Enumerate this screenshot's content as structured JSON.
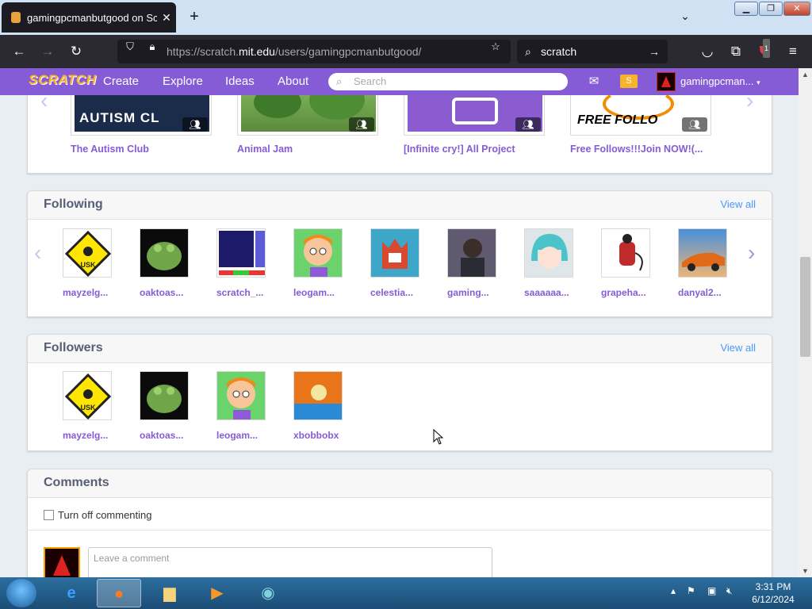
{
  "browser": {
    "tab_title": "gamingpcmanbutgood on Scratch",
    "url_prefix": "https://scratch.",
    "url_domain": "mit.edu",
    "url_path": "/users/gamingpcmanbutgood/",
    "search_value": "scratch",
    "extension_badge": "1"
  },
  "header": {
    "logo": "SCRATCH",
    "nav": [
      "Create",
      "Explore",
      "Ideas",
      "About"
    ],
    "search_placeholder": "Search",
    "username": "gamingpcman..."
  },
  "studios": {
    "items": [
      {
        "name": "The Autism Club",
        "thumb_text": "AUTISM CL"
      },
      {
        "name": "Animal Jam",
        "thumb_text": ""
      },
      {
        "name": "[Infinite cry!] All Project",
        "thumb_text": ""
      },
      {
        "name": "Free Follows!!!Join NOW!(...",
        "thumb_text": "FREE FOLLO"
      }
    ]
  },
  "following": {
    "title": "Following",
    "view_all": "View all",
    "users": [
      "mayzelg...",
      "oaktoas...",
      "scratch_...",
      "leogam...",
      "celestia...",
      "gaming...",
      "saaaaaa...",
      "grapeha...",
      "danyal2..."
    ]
  },
  "followers": {
    "title": "Followers",
    "view_all": "View all",
    "users": [
      "mayzelg...",
      "oaktoas...",
      "leogam...",
      "xbobbobx"
    ]
  },
  "comments": {
    "title": "Comments",
    "toggle_label": "Turn off commenting",
    "placeholder": "Leave a comment"
  },
  "taskbar": {
    "time": "3:31 PM",
    "date": "6/12/2024"
  },
  "colors": {
    "scratch_purple": "#855cd6",
    "link_blue": "#4d97ff"
  }
}
